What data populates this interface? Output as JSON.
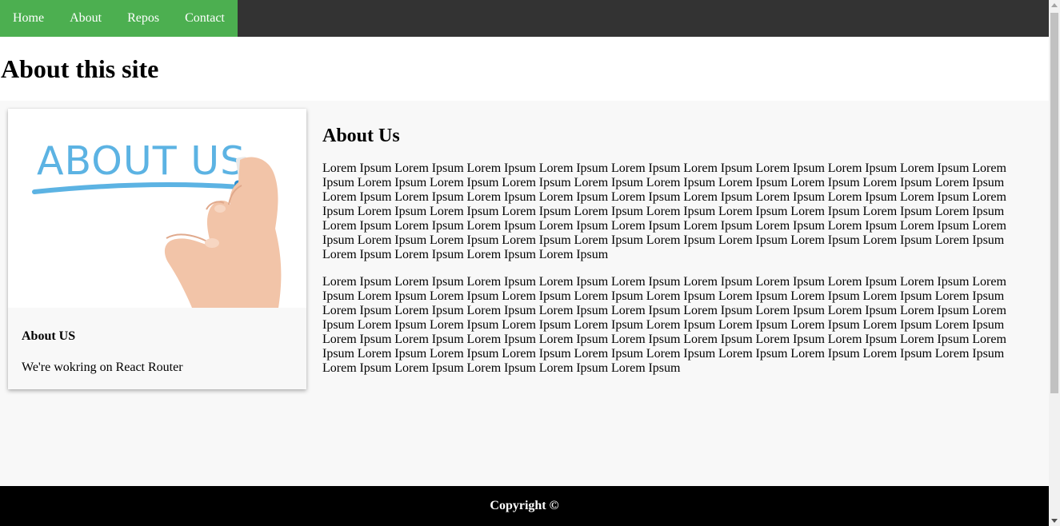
{
  "nav": {
    "items": [
      {
        "label": "Home"
      },
      {
        "label": "About"
      },
      {
        "label": "Repos"
      },
      {
        "label": "Contact"
      }
    ]
  },
  "page": {
    "title": "About this site"
  },
  "card": {
    "image_text": "ABOUT US",
    "title": "About US",
    "text": "We're wokring on React Router"
  },
  "content": {
    "title": "About Us",
    "paragraphs": [
      "Lorem Ipsum Lorem Ipsum Lorem Ipsum Lorem Ipsum Lorem Ipsum Lorem Ipsum Lorem Ipsum Lorem Ipsum Lorem Ipsum Lorem Ipsum Lorem Ipsum Lorem Ipsum Lorem Ipsum Lorem Ipsum Lorem Ipsum Lorem Ipsum Lorem Ipsum Lorem Ipsum Lorem Ipsum Lorem Ipsum Lorem Ipsum Lorem Ipsum Lorem Ipsum Lorem Ipsum Lorem Ipsum Lorem Ipsum Lorem Ipsum Lorem Ipsum Lorem Ipsum Lorem Ipsum Lorem Ipsum Lorem Ipsum Lorem Ipsum Lorem Ipsum Lorem Ipsum Lorem Ipsum Lorem Ipsum Lorem Ipsum Lorem Ipsum Lorem Ipsum Lorem Ipsum Lorem Ipsum Lorem Ipsum Lorem Ipsum Lorem Ipsum Lorem Ipsum Lorem Ipsum Lorem Ipsum Lorem Ipsum Lorem Ipsum Lorem Ipsum Lorem Ipsum Lorem Ipsum Lorem Ipsum Lorem Ipsum Lorem Ipsum Lorem Ipsum Lorem Ipsum Lorem Ipsum Lorem Ipsum Lorem Ipsum",
      "Lorem Ipsum Lorem Ipsum Lorem Ipsum Lorem Ipsum Lorem Ipsum Lorem Ipsum Lorem Ipsum Lorem Ipsum Lorem Ipsum Lorem Ipsum Lorem Ipsum Lorem Ipsum Lorem Ipsum Lorem Ipsum Lorem Ipsum Lorem Ipsum Lorem Ipsum Lorem Ipsum Lorem Ipsum Lorem Ipsum Lorem Ipsum Lorem Ipsum Lorem Ipsum Lorem Ipsum Lorem Ipsum Lorem Ipsum Lorem Ipsum Lorem Ipsum Lorem Ipsum Lorem Ipsum Lorem Ipsum Lorem Ipsum Lorem Ipsum Lorem Ipsum Lorem Ipsum Lorem Ipsum Lorem Ipsum Lorem Ipsum Lorem Ipsum Lorem Ipsum Lorem Ipsum Lorem Ipsum Lorem Ipsum Lorem Ipsum Lorem Ipsum Lorem Ipsum Lorem Ipsum Lorem Ipsum Lorem Ipsum Lorem Ipsum Lorem Ipsum Lorem Ipsum Lorem Ipsum Lorem Ipsum Lorem Ipsum Lorem Ipsum Lorem Ipsum Lorem Ipsum Lorem Ipsum Lorem Ipsum Lorem Ipsum Lorem Ipsum"
    ]
  },
  "footer": {
    "text": "Copyright ©"
  },
  "colors": {
    "nav_bg": "#333333",
    "nav_active_bg": "#4caf50",
    "main_bg": "#f8f8f8",
    "footer_bg": "#000000",
    "image_text": "#5cb3e3"
  }
}
